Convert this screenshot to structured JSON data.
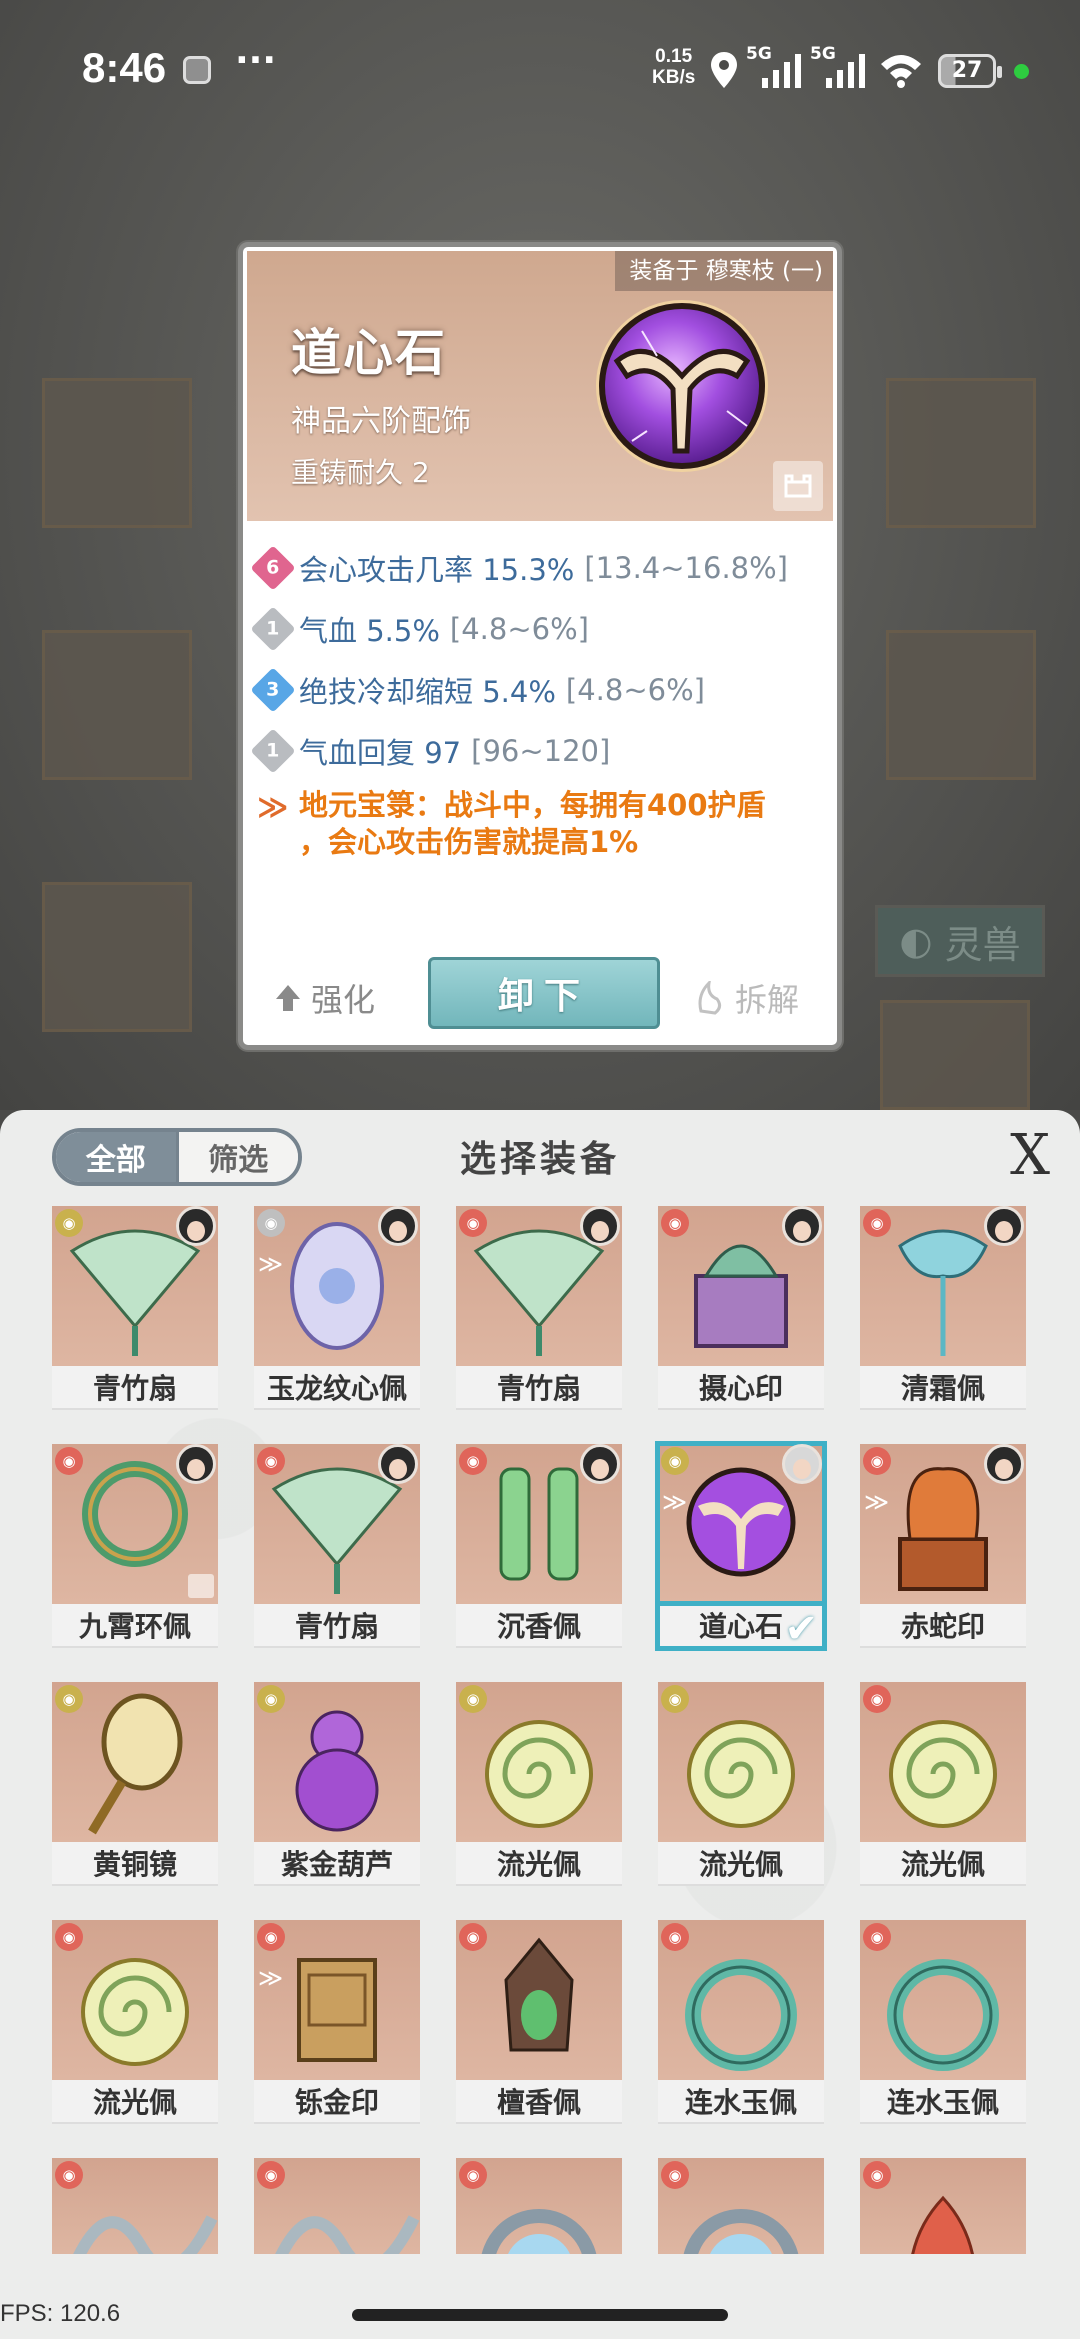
{
  "status_bar": {
    "time": "8:46",
    "more": "···",
    "net_speed_value": "0.15",
    "net_speed_unit": "KB/s",
    "sim1": "5G",
    "sim2": "5G",
    "battery": "27"
  },
  "background": {
    "tab_label": "灵兽"
  },
  "detail_card": {
    "equipped_on": "装备于 穆寒枝 (一)",
    "name": "道心石",
    "grade": "神品六阶配饰",
    "durability": "重铸耐久 2",
    "stats": [
      {
        "rank": "6",
        "rank_color": "#e0658f",
        "text": "会心攻击几率 15.3%",
        "range": "[13.4~16.8%]"
      },
      {
        "rank": "1",
        "rank_color": "#b9bcc0",
        "text": "气血 5.5%",
        "range": "[4.8~6%]"
      },
      {
        "rank": "3",
        "rank_color": "#58a6e6",
        "text": "绝技冷却缩短 5.4%",
        "range": "[4.8~6%]"
      },
      {
        "rank": "1",
        "rank_color": "#b9bcc0",
        "text": "气血回复 97",
        "range": "[96~120]"
      }
    ],
    "set_effect_line1": "地元宝箓：战斗中，每拥有400护盾",
    "set_effect_line2": "，会心攻击伤害就提高1%",
    "enhance_label": "强化",
    "unequip_label": "卸下",
    "dismantle_label": "拆解",
    "accent_color": "#e97a12"
  },
  "panel": {
    "filter_all": "全部",
    "filter_screen": "筛选",
    "title": "选择装备",
    "close_label": "X",
    "items": [
      {
        "name": "青竹扇",
        "quality": "gold",
        "icon": "fan-icon",
        "avatar": true
      },
      {
        "name": "玉龙纹心佩",
        "quality": "white",
        "icon": "jade-pendant-icon",
        "avatar": true,
        "set": true
      },
      {
        "name": "青竹扇",
        "quality": "red",
        "icon": "fan-icon",
        "avatar": true
      },
      {
        "name": "摄心印",
        "quality": "red",
        "icon": "seal-icon",
        "avatar": true
      },
      {
        "name": "清霜佩",
        "quality": "red",
        "icon": "frost-pendant-icon",
        "avatar": true
      },
      {
        "name": "九霄环佩",
        "quality": "red",
        "icon": "ring-pendant-icon",
        "avatar": true,
        "locked": true
      },
      {
        "name": "青竹扇",
        "quality": "red",
        "icon": "fan-icon",
        "avatar": true
      },
      {
        "name": "沉香佩",
        "quality": "red",
        "icon": "agarwood-pendant-icon",
        "avatar": true
      },
      {
        "name": "道心石",
        "quality": "gold",
        "icon": "purple-orb-icon",
        "avatar": true,
        "set": true,
        "selected": true
      },
      {
        "name": "赤蛇印",
        "quality": "red",
        "icon": "snake-seal-icon",
        "avatar": true,
        "set": true
      },
      {
        "name": "黄铜镜",
        "quality": "gold",
        "icon": "mirror-icon"
      },
      {
        "name": "紫金葫芦",
        "quality": "gold",
        "icon": "gourd-icon"
      },
      {
        "name": "流光佩",
        "quality": "gold",
        "icon": "swirl-pendant-icon"
      },
      {
        "name": "流光佩",
        "quality": "gold",
        "icon": "swirl-pendant-icon"
      },
      {
        "name": "流光佩",
        "quality": "red",
        "icon": "swirl-pendant-icon"
      },
      {
        "name": "流光佩",
        "quality": "red",
        "icon": "swirl-pendant-icon"
      },
      {
        "name": "铄金印",
        "quality": "red",
        "icon": "gold-seal-icon",
        "set": true
      },
      {
        "name": "檀香佩",
        "quality": "red",
        "icon": "sandalwood-pendant-icon"
      },
      {
        "name": "连水玉佩",
        "quality": "red",
        "icon": "water-jade-icon"
      },
      {
        "name": "连水玉佩",
        "quality": "red",
        "icon": "water-jade-icon"
      },
      {
        "name": "",
        "quality": "red",
        "icon": "chain-icon"
      },
      {
        "name": "",
        "quality": "red",
        "icon": "chain-icon"
      },
      {
        "name": "",
        "quality": "red",
        "icon": "bead-ring-icon"
      },
      {
        "name": "",
        "quality": "red",
        "icon": "bead-ring-icon"
      },
      {
        "name": "",
        "quality": "red",
        "icon": "flame-stone-icon"
      }
    ]
  },
  "debug": {
    "fps": "FPS: 120.6"
  }
}
